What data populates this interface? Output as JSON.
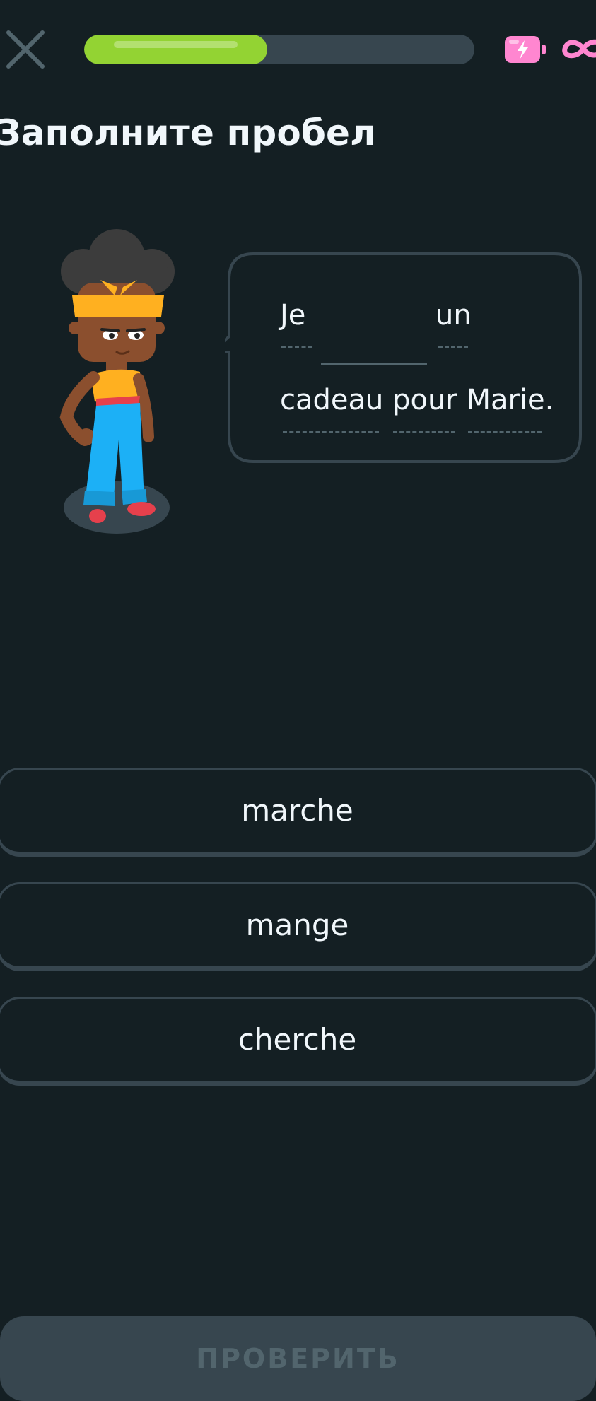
{
  "header": {
    "close_icon": "close-icon",
    "progress": 0.47,
    "progress_color": "#93d333",
    "energy_icon": "energy-battery-icon",
    "energy_color": "#ff86d0",
    "infinity_icon": "infinity-icon"
  },
  "title": "Заполните пробел",
  "character_icon": "character-illustration",
  "sentence": {
    "word1": "Je",
    "word2": "un",
    "line2": "cadeau pour Marie."
  },
  "choices": [
    {
      "label": "marche"
    },
    {
      "label": "mange"
    },
    {
      "label": "cherche"
    }
  ],
  "check_button": {
    "label": "ПРОВЕРИТЬ"
  },
  "colors": {
    "background": "#141f23",
    "border": "#37464f",
    "text": "#f1f7fb"
  }
}
